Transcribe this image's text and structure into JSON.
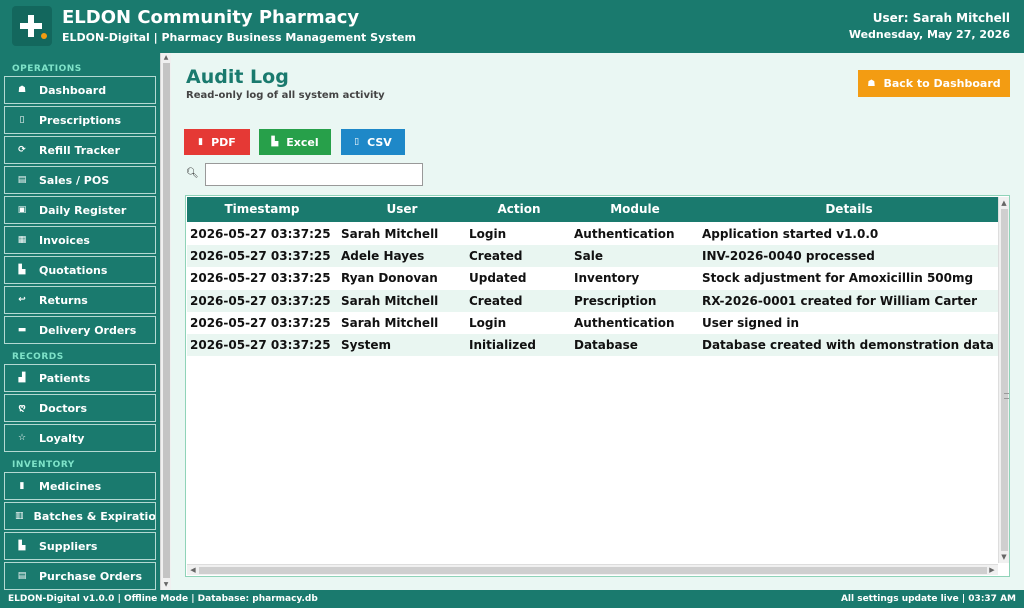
{
  "header": {
    "title": "ELDON Community Pharmacy",
    "subtitle": "ELDON-Digital  |  Pharmacy Business Management System",
    "user": "User: Sarah Mitchell",
    "date": "Wednesday, May 27, 2026"
  },
  "sidebar": {
    "operations_label": "OPERATIONS",
    "operations": [
      {
        "label": "Dashboard",
        "icon": "home-icon",
        "glyph": "☗"
      },
      {
        "label": "Prescriptions",
        "icon": "clipboard-icon",
        "glyph": "▯"
      },
      {
        "label": "Refill Tracker",
        "icon": "refill-icon",
        "glyph": "⟳"
      },
      {
        "label": "Sales / POS",
        "icon": "cash-register-icon",
        "glyph": "▤"
      },
      {
        "label": "Daily Register",
        "icon": "register-icon",
        "glyph": "▣"
      },
      {
        "label": "Invoices",
        "icon": "invoice-icon",
        "glyph": "▦"
      },
      {
        "label": "Quotations",
        "icon": "quotation-icon",
        "glyph": "▙"
      },
      {
        "label": "Returns",
        "icon": "return-arrow-icon",
        "glyph": "↩"
      },
      {
        "label": "Delivery Orders",
        "icon": "truck-icon",
        "glyph": "▬"
      }
    ],
    "records_label": "RECORDS",
    "records": [
      {
        "label": "Patients",
        "icon": "people-icon",
        "glyph": "▟"
      },
      {
        "label": "Doctors",
        "icon": "stethoscope-icon",
        "glyph": "ღ"
      },
      {
        "label": "Loyalty",
        "icon": "star-icon",
        "glyph": "☆"
      }
    ],
    "inventory_label": "INVENTORY",
    "inventory": [
      {
        "label": "Medicines",
        "icon": "pill-icon",
        "glyph": "▮"
      },
      {
        "label": "Batches & Expiration",
        "icon": "boxes-icon",
        "glyph": "▥"
      },
      {
        "label": "Suppliers",
        "icon": "factory-icon",
        "glyph": "▙"
      },
      {
        "label": "Purchase Orders",
        "icon": "cart-icon",
        "glyph": "▤"
      }
    ]
  },
  "main": {
    "title": "Audit Log",
    "subtitle": "Read-only log of all system activity",
    "back_label": "Back to Dashboard",
    "export_buttons": {
      "pdf": "PDF",
      "excel": "Excel",
      "csv": "CSV"
    },
    "search": {
      "value": "",
      "placeholder": ""
    }
  },
  "table": {
    "columns": [
      "Timestamp",
      "User",
      "Action",
      "Module",
      "Details"
    ],
    "rows": [
      [
        "2026-05-27 03:37:25",
        "Sarah Mitchell",
        "Login",
        "Authentication",
        "Application started v1.0.0"
      ],
      [
        "2026-05-27 03:37:25",
        "Adele Hayes",
        "Created",
        "Sale",
        "INV-2026-0040 processed"
      ],
      [
        "2026-05-27 03:37:25",
        "Ryan Donovan",
        "Updated",
        "Inventory",
        "Stock adjustment for Amoxicillin 500mg"
      ],
      [
        "2026-05-27 03:37:25",
        "Sarah Mitchell",
        "Created",
        "Prescription",
        "RX-2026-0001 created for William Carter"
      ],
      [
        "2026-05-27 03:37:25",
        "Sarah Mitchell",
        "Login",
        "Authentication",
        "User signed in"
      ],
      [
        "2026-05-27 03:37:25",
        "System",
        "Initialized",
        "Database",
        "Database created with demonstration data"
      ]
    ]
  },
  "footer": {
    "left": "ELDON-Digital v1.0.0  |  Offline Mode  |  Database: pharmacy.db",
    "right": "All settings update live  |  03:37 AM"
  },
  "colors": {
    "brand": "#1a7a6e",
    "accent_orange": "#f39c12",
    "pdf": "#e53935",
    "excel": "#27a04a",
    "csv": "#1e88c8"
  }
}
